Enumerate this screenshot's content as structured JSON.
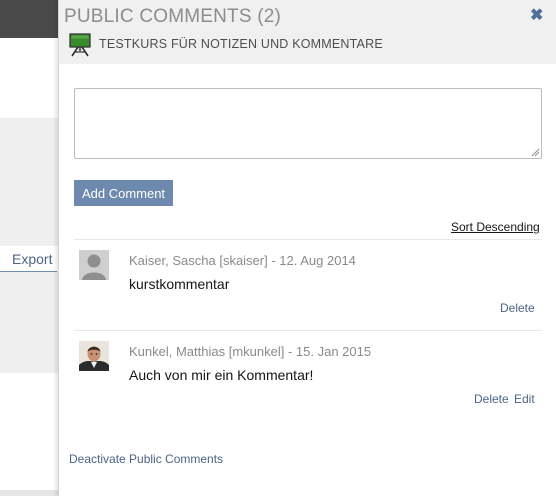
{
  "background": {
    "export_label": "Export"
  },
  "panel": {
    "title": "PUBLIC COMMENTS (2)",
    "close_icon": "close-icon",
    "course_icon": "course-board-icon",
    "course_title": "TESTKURS FÜR NOTIZEN UND KOMMENTARE",
    "comment_input_value": "",
    "add_button_label": "Add Comment",
    "sort_label": "Sort Descending",
    "comments": [
      {
        "author": "Kaiser, Sascha [skaiser]",
        "date": "12. Aug 2014",
        "meta": "Kaiser, Sascha [skaiser] - 12. Aug 2014",
        "text": "kurstkommentar",
        "avatar": "placeholder-avatar",
        "actions": [
          "Delete"
        ]
      },
      {
        "author": "Kunkel, Matthias [mkunkel]",
        "date": "15. Jan 2015",
        "meta": "Kunkel, Matthias [mkunkel] - 15. Jan 2015",
        "text": "Auch von mir ein Kommentar!",
        "avatar": "photo-avatar",
        "actions": [
          "Delete",
          "Edit"
        ]
      }
    ],
    "deactivate_label": "Deactivate Public Comments"
  },
  "colors": {
    "accent_button": "#6d89ae",
    "link": "#4c6586",
    "close_icon": "#4d6f98",
    "header_bg": "#f0f0f0",
    "meta_text": "#8a8a8a"
  }
}
